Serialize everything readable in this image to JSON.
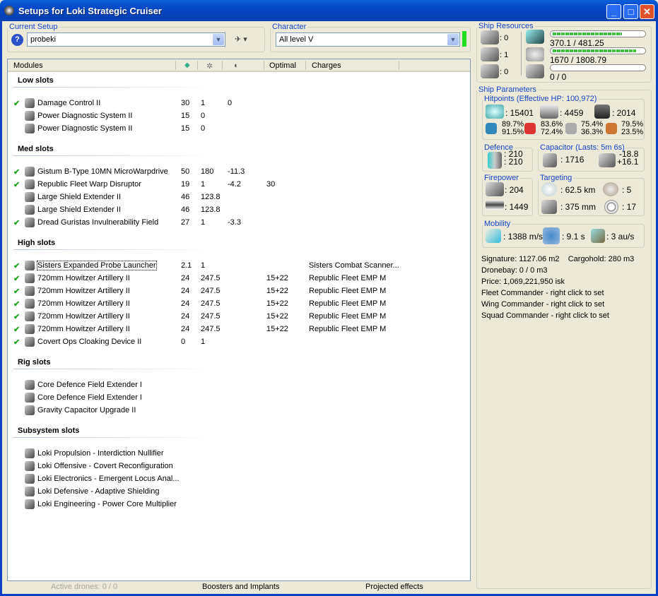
{
  "window": {
    "title": "Setups for Loki Strategic Cruiser",
    "min": "_",
    "max": "□",
    "close": "✕"
  },
  "setup": {
    "legend": "Current Setup",
    "value": "probeki"
  },
  "character": {
    "legend": "Character",
    "value": "All level V",
    "status_color": "#22dd22"
  },
  "columns": {
    "modules": "Modules",
    "optimal": "Optimal",
    "charges": "Charges"
  },
  "sections": [
    {
      "title": "Low slots",
      "rows": [
        {
          "check": true,
          "name": "Damage Control II",
          "c1": "30",
          "c2": "1",
          "c3": "0",
          "opt": "",
          "ch": ""
        },
        {
          "check": false,
          "name": "Power Diagnostic System II",
          "c1": "15",
          "c2": "0",
          "c3": "",
          "opt": "",
          "ch": ""
        },
        {
          "check": false,
          "name": "Power Diagnostic System II",
          "c1": "15",
          "c2": "0",
          "c3": "",
          "opt": "",
          "ch": ""
        }
      ]
    },
    {
      "title": "Med slots",
      "rows": [
        {
          "check": true,
          "name": "Gistum B-Type 10MN MicroWarpdrive",
          "c1": "50",
          "c2": "180",
          "c3": "-11.3",
          "opt": "",
          "ch": ""
        },
        {
          "check": true,
          "name": "Republic Fleet Warp Disruptor",
          "c1": "19",
          "c2": "1",
          "c3": "-4.2",
          "opt": "30",
          "ch": ""
        },
        {
          "check": false,
          "name": "Large Shield Extender II",
          "c1": "46",
          "c2": "123.8",
          "c3": "",
          "opt": "",
          "ch": ""
        },
        {
          "check": false,
          "name": "Large Shield Extender II",
          "c1": "46",
          "c2": "123.8",
          "c3": "",
          "opt": "",
          "ch": ""
        },
        {
          "check": true,
          "name": "Dread Guristas Invulnerability Field",
          "c1": "27",
          "c2": "1",
          "c3": "-3.3",
          "opt": "",
          "ch": ""
        }
      ]
    },
    {
      "title": "High slots",
      "rows": [
        {
          "check": true,
          "name": "Sisters Expanded Probe Launcher",
          "c1": "2.1",
          "c2": "1",
          "c3": "",
          "opt": "",
          "ch": "Sisters Combat Scanner..."
        },
        {
          "check": true,
          "name": "720mm Howitzer Artillery II",
          "c1": "24",
          "c2": "247.5",
          "c3": "",
          "opt": "15+22",
          "ch": "Republic Fleet EMP M"
        },
        {
          "check": true,
          "name": "720mm Howitzer Artillery II",
          "c1": "24",
          "c2": "247.5",
          "c3": "",
          "opt": "15+22",
          "ch": "Republic Fleet EMP M"
        },
        {
          "check": true,
          "name": "720mm Howitzer Artillery II",
          "c1": "24",
          "c2": "247.5",
          "c3": "",
          "opt": "15+22",
          "ch": "Republic Fleet EMP M"
        },
        {
          "check": true,
          "name": "720mm Howitzer Artillery II",
          "c1": "24",
          "c2": "247.5",
          "c3": "",
          "opt": "15+22",
          "ch": "Republic Fleet EMP M"
        },
        {
          "check": true,
          "name": "720mm Howitzer Artillery II",
          "c1": "24",
          "c2": "247.5",
          "c3": "",
          "opt": "15+22",
          "ch": "Republic Fleet EMP M"
        },
        {
          "check": true,
          "name": "Covert Ops Cloaking Device II",
          "c1": "0",
          "c2": "1",
          "c3": "",
          "opt": "",
          "ch": ""
        }
      ]
    },
    {
      "title": "Rig slots",
      "rows": [
        {
          "check": false,
          "name": "Core Defence Field Extender I",
          "c1": "",
          "c2": "",
          "c3": "",
          "opt": "",
          "ch": ""
        },
        {
          "check": false,
          "name": "Core Defence Field Extender I",
          "c1": "",
          "c2": "",
          "c3": "",
          "opt": "",
          "ch": ""
        },
        {
          "check": false,
          "name": "Gravity Capacitor Upgrade II",
          "c1": "",
          "c2": "",
          "c3": "",
          "opt": "",
          "ch": ""
        }
      ]
    },
    {
      "title": "Subsystem slots",
      "rows": [
        {
          "check": false,
          "name": "Loki Propulsion - Interdiction Nullifier",
          "c1": "",
          "c2": "",
          "c3": "",
          "opt": "",
          "ch": ""
        },
        {
          "check": false,
          "name": "Loki Offensive - Covert Reconfiguration",
          "c1": "",
          "c2": "",
          "c3": "",
          "opt": "",
          "ch": ""
        },
        {
          "check": false,
          "name": "Loki Electronics - Emergent Locus Anal...",
          "c1": "",
          "c2": "",
          "c3": "",
          "opt": "",
          "ch": ""
        },
        {
          "check": false,
          "name": "Loki Defensive - Adaptive Shielding",
          "c1": "",
          "c2": "",
          "c3": "",
          "opt": "",
          "ch": ""
        },
        {
          "check": false,
          "name": "Loki Engineering - Power Core Multiplier",
          "c1": "",
          "c2": "",
          "c3": "",
          "opt": "",
          "ch": ""
        }
      ]
    }
  ],
  "bottom": {
    "drones": "Active drones: 0 / 0",
    "boosters": "Boosters and Implants",
    "projected": "Projected effects"
  },
  "resources": {
    "legend": "Ship Resources",
    "turrets": ": 0",
    "launchers": ": 1",
    "rigs": ": 0",
    "cpu": "370.1 / 481.25",
    "cpu_fraction": 0.769,
    "power": "1670 / 1808.79",
    "power_fraction": 0.923,
    "drone_bw": "0 / 0",
    "drone_fraction": 0
  },
  "params": {
    "legend": "Ship Parameters",
    "hp": {
      "legend": "Hitpoints (Effective HP: 100,972)",
      "shield": ": 15401",
      "armor": ": 4459",
      "structure": ": 2014",
      "em": [
        "89.7%",
        "91.5%"
      ],
      "thermal": [
        "83.6%",
        "72.4%"
      ],
      "kinetic": [
        "75.4%",
        "36.3%"
      ],
      "explosive": [
        "79.5%",
        "23.5%"
      ]
    },
    "defence": {
      "legend": "Defence",
      "a": ": 210",
      "b": ": 210"
    },
    "capacitor": {
      "legend": "Capacitor (Lasts: 5m 6s)",
      "cap": ": 1716",
      "use": "-18.8",
      "recharge": "+16.1"
    },
    "firepower": {
      "legend": "Firepower",
      "turret": ": 204",
      "missile": ": 1449"
    },
    "targeting": {
      "legend": "Targeting",
      "range": ": 62.5 km",
      "res": ": 375 mm",
      "targets": ": 5",
      "scan": ": 17"
    },
    "mobility": {
      "legend": "Mobility",
      "speed": ": 1388 m/s",
      "align": ": 9.1 s",
      "warp": ": 3 au/s"
    }
  },
  "info": {
    "signature": "Signature: 1127.06 m2",
    "cargo": "Cargohold: 280 m3",
    "dronebay": "Dronebay: 0 / 0 m3",
    "price": "Price: 1,069,221,950 isk",
    "fleet": "Fleet Commander - right click to set",
    "wing": "Wing Commander - right click to set",
    "squad": "Squad Commander - right click to set"
  }
}
